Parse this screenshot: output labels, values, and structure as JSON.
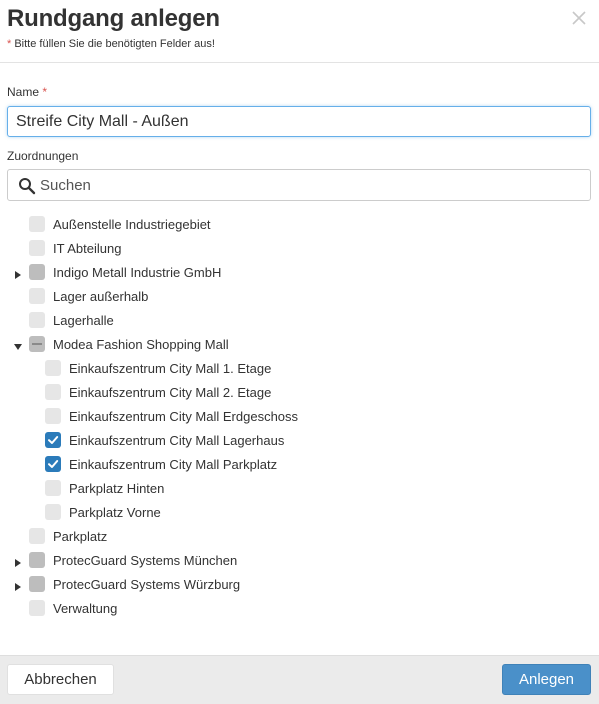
{
  "dialog": {
    "title": "Rundgang anlegen",
    "required_star": "*",
    "required_hint": " Bitte füllen Sie die benötigten Felder aus!"
  },
  "name_field": {
    "label": "Name",
    "required_star": "*",
    "value": "Streife City Mall - Außen"
  },
  "assignments": {
    "label": "Zuordnungen",
    "search_placeholder": "Suchen"
  },
  "tree": [
    {
      "label": "Außenstelle Industriegebiet",
      "level": 0,
      "expandable": false,
      "state": "unchecked"
    },
    {
      "label": "IT Abteilung",
      "level": 0,
      "expandable": false,
      "state": "unchecked"
    },
    {
      "label": "Indigo Metall Industrie GmbH",
      "level": 0,
      "expandable": true,
      "expanded": false,
      "state": "partial"
    },
    {
      "label": "Lager außerhalb",
      "level": 0,
      "expandable": false,
      "state": "unchecked"
    },
    {
      "label": "Lagerhalle",
      "level": 0,
      "expandable": false,
      "state": "unchecked"
    },
    {
      "label": "Modea Fashion Shopping Mall",
      "level": 0,
      "expandable": true,
      "expanded": true,
      "state": "indeterminate"
    },
    {
      "label": "Einkaufszentrum City Mall 1. Etage",
      "level": 1,
      "expandable": false,
      "state": "unchecked"
    },
    {
      "label": "Einkaufszentrum City Mall 2. Etage",
      "level": 1,
      "expandable": false,
      "state": "unchecked"
    },
    {
      "label": "Einkaufszentrum City Mall Erdgeschoss",
      "level": 1,
      "expandable": false,
      "state": "unchecked"
    },
    {
      "label": "Einkaufszentrum City Mall Lagerhaus",
      "level": 1,
      "expandable": false,
      "state": "checked"
    },
    {
      "label": "Einkaufszentrum City Mall Parkplatz",
      "level": 1,
      "expandable": false,
      "state": "checked"
    },
    {
      "label": "Parkplatz Hinten",
      "level": 1,
      "expandable": false,
      "state": "unchecked"
    },
    {
      "label": "Parkplatz Vorne",
      "level": 1,
      "expandable": false,
      "state": "unchecked"
    },
    {
      "label": "Parkplatz",
      "level": 0,
      "expandable": false,
      "state": "unchecked"
    },
    {
      "label": "ProtecGuard Systems München",
      "level": 0,
      "expandable": true,
      "expanded": false,
      "state": "partial"
    },
    {
      "label": "ProtecGuard Systems Würzburg",
      "level": 0,
      "expandable": true,
      "expanded": false,
      "state": "partial"
    },
    {
      "label": "Verwaltung",
      "level": 0,
      "expandable": false,
      "state": "unchecked"
    }
  ],
  "footer": {
    "cancel_label": "Abbrechen",
    "create_label": "Anlegen"
  },
  "colors": {
    "accent": "#4a90c9",
    "checkbox_checked": "#2b7bba",
    "required": "#d9534f"
  }
}
